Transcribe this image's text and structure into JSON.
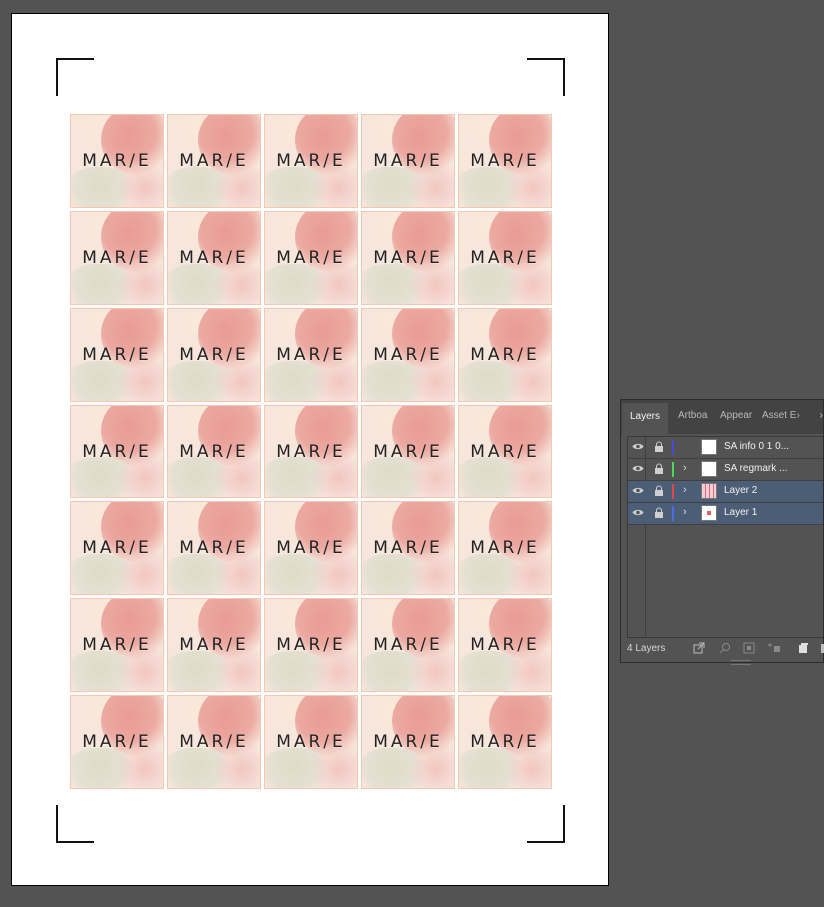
{
  "artboard": {
    "tile_text": "MAR/E",
    "rows": 7,
    "columns": 5
  },
  "layers_panel": {
    "tabs": [
      {
        "label": "Layers",
        "active": true
      },
      {
        "label": "Artboa"
      },
      {
        "label": "Appear"
      },
      {
        "label": "Asset E›"
      }
    ],
    "close_label": "›",
    "layers": [
      {
        "name": "SA info 0 1 0...",
        "color": "#4a4ad8",
        "expandable": false,
        "selected": false,
        "thumb": "blank"
      },
      {
        "name": "SA regmark ...",
        "color": "#4ed85a",
        "expandable": true,
        "selected": false,
        "thumb": "blank"
      },
      {
        "name": "Layer 2",
        "color": "#e64848",
        "expandable": true,
        "selected": true,
        "thumb": "pink"
      },
      {
        "name": "Layer 1",
        "color": "#4a6fe0",
        "expandable": true,
        "selected": true,
        "thumb": "dot"
      }
    ],
    "footer": {
      "count_label": "4 Layers",
      "icons": [
        "export-icon",
        "search-icon",
        "clipping-mask-icon",
        "new-sublayer-icon",
        "new-layer-icon",
        "trash-icon"
      ]
    }
  }
}
